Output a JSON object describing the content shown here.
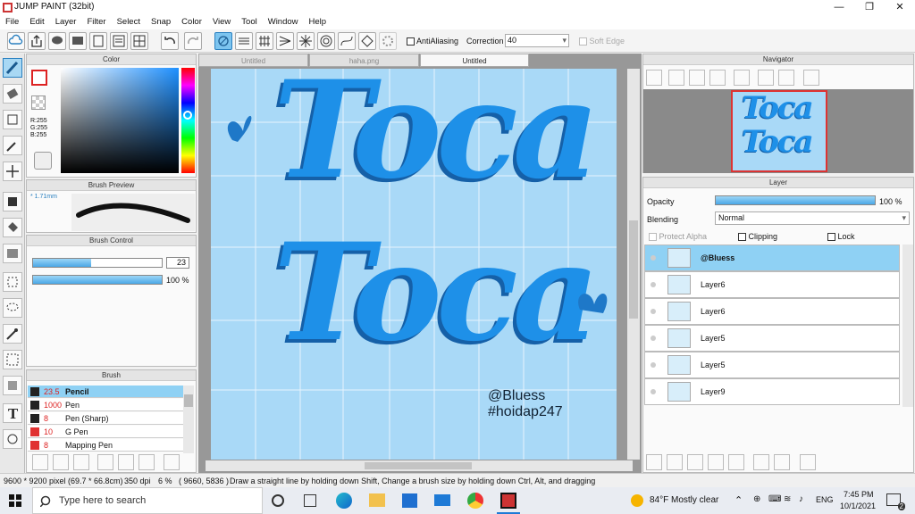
{
  "app": {
    "title": "JUMP PAINT (32bit)"
  },
  "menu": [
    "File",
    "Edit",
    "Layer",
    "Filter",
    "Select",
    "Snap",
    "Color",
    "View",
    "Tool",
    "Window",
    "Help"
  ],
  "toolbar": {
    "antialiasing": "AntiAliasing",
    "correction_label": "Correction",
    "correction_value": "40",
    "softedge": "Soft Edge"
  },
  "color_panel": {
    "title": "Color",
    "r": "R:255",
    "g": "G:255",
    "b": "B:255"
  },
  "brush_preview": {
    "title": "Brush Preview",
    "size": "* 1.71mm"
  },
  "brush_control": {
    "title": "Brush Control",
    "size_value": "23",
    "size_fill": 0.45,
    "opacity_value": "100 %",
    "opacity_fill": 1.0
  },
  "brush_panel": {
    "title": "Brush",
    "items": [
      {
        "size": "23.5",
        "name": "Pencil",
        "color": "#222222",
        "selected": true
      },
      {
        "size": "1000",
        "name": "Pen",
        "color": "#222222"
      },
      {
        "size": "8",
        "name": "Pen (Sharp)",
        "color": "#222222"
      },
      {
        "size": "10",
        "name": "G Pen",
        "color": "#e03030"
      },
      {
        "size": "8",
        "name": "Mapping Pen",
        "color": "#e03030"
      }
    ]
  },
  "tabs": [
    "Untitled",
    "haha.png",
    "Untitled"
  ],
  "canvas": {
    "line1": "Toca",
    "line2": "Toca",
    "sig1": "@Bluess",
    "sig2": "#hoidap247"
  },
  "navigator": {
    "title": "Navigator"
  },
  "layer_panel": {
    "title": "Layer",
    "opacity_label": "Opacity",
    "opacity_value": "100 %",
    "blending_label": "Blending",
    "blending_value": "Normal",
    "protect_alpha": "Protect Alpha",
    "clipping": "Clipping",
    "lock": "Lock",
    "layers": [
      {
        "name": "@Bluess",
        "selected": true
      },
      {
        "name": "Layer6"
      },
      {
        "name": "Layer6"
      },
      {
        "name": "Layer5"
      },
      {
        "name": "Layer5"
      },
      {
        "name": "Layer9"
      }
    ]
  },
  "status": {
    "size": "9600 * 9200 pixel",
    "mm": "(69.7 * 66.8cm)",
    "dpi": "350 dpi",
    "zoom": "6 %",
    "coords": "( 9660, 5836 )",
    "hint": "Draw a straight line by holding down Shift, Change a brush size by holding down Ctrl, Alt, and dragging"
  },
  "taskbar": {
    "search": "Type here to search",
    "weather": "84°F  Mostly clear",
    "lang": "ENG",
    "time": "7:45 PM",
    "date": "10/1/2021",
    "notif": "2"
  },
  "colors": {
    "accent": "#2a80c0",
    "canvas": "#a9d9f7",
    "letters": "#1e90e8"
  }
}
